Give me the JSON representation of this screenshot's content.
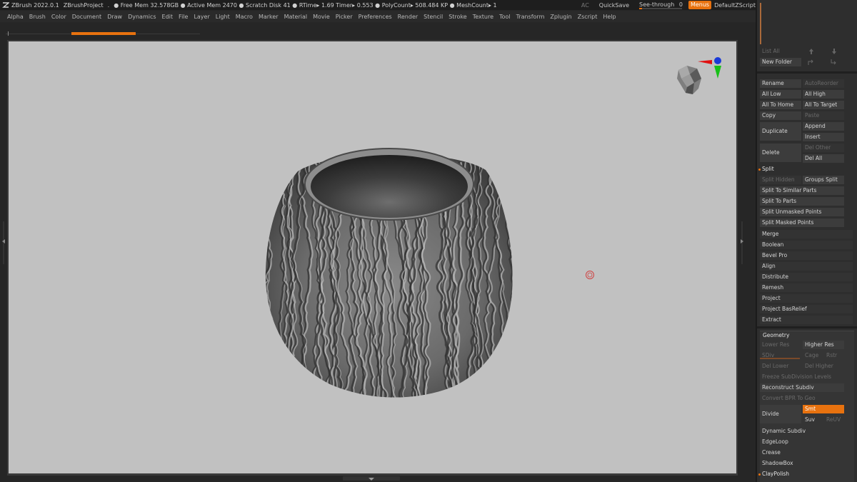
{
  "titlebar": {
    "app": "ZBrush 2022.0.1",
    "project": "ZBrushProject",
    "dot": ".",
    "stats": "● Free Mem 32.578GB ● Active Mem 2470 ● Scratch Disk 41 ●  RTime▸ 1.69 Timer▸ 0.553 ● PolyCount▸ 508.484 KP  ● MeshCount▸ 1",
    "ac": "AC",
    "quicksave": "QuickSave",
    "seethrough": "See-through",
    "seethrough_value": "0",
    "seethrough_level": 0.05,
    "menus": "Menus",
    "script": "DefaultZScript"
  },
  "menubar": [
    "Alpha",
    "Brush",
    "Color",
    "Document",
    "Draw",
    "Dynamics",
    "Edit",
    "File",
    "Layer",
    "Light",
    "Macro",
    "Marker",
    "Material",
    "Movie",
    "Picker",
    "Preferences",
    "Render",
    "Stencil",
    "Stroke",
    "Texture",
    "Tool",
    "Transform",
    "Zplugin",
    "Zscript",
    "Help"
  ],
  "subtool": {
    "list_all": "List All",
    "new_folder": "New Folder",
    "rename": "Rename",
    "auto_reorder": "AutoReorder",
    "all_low": "All Low",
    "all_high": "All High",
    "all_to_home": "All To Home",
    "all_to_target": "All To Target",
    "copy": "Copy",
    "paste": "Paste",
    "duplicate": "Duplicate",
    "append": "Append",
    "insert": "Insert",
    "delete": "Delete",
    "del_other": "Del Other",
    "del_all": "Del All",
    "split": "Split",
    "split_hidden": "Split Hidden",
    "groups_split": "Groups Split",
    "split_similar": "Split To Similar Parts",
    "split_parts": "Split To Parts",
    "split_unmasked": "Split Unmasked Points",
    "split_masked": "Split Masked Points",
    "merge": "Merge",
    "boolean": "Boolean",
    "bevel_pro": "Bevel Pro",
    "align": "Align",
    "distribute": "Distribute",
    "remesh": "Remesh",
    "project": "Project",
    "project_basrelief": "Project BasRelief",
    "extract": "Extract"
  },
  "geometry": {
    "title": "Geometry",
    "lower_res": "Lower Res",
    "higher_res": "Higher Res",
    "sdiv": "SDiv",
    "cage": "Cage",
    "rstr": "Rstr",
    "del_lower": "Del Lower",
    "del_higher": "Del Higher",
    "freeze": "Freeze SubDivision Levels",
    "reconstruct": "Reconstruct Subdiv",
    "convert_bpr": "Convert BPR To Geo",
    "divide": "Divide",
    "smt": "Smt",
    "suv": "Suv",
    "reuv": "ReUV",
    "dynamic_subdiv": "Dynamic Subdiv",
    "edgeloop": "EdgeLoop",
    "crease": "Crease",
    "shadowbox": "ShadowBox",
    "claypolish": "ClayPolish"
  },
  "colors": {
    "accent": "#e8720f",
    "canvas_bg": "#c1c1c1",
    "panel_bg": "#2e2e2e"
  }
}
